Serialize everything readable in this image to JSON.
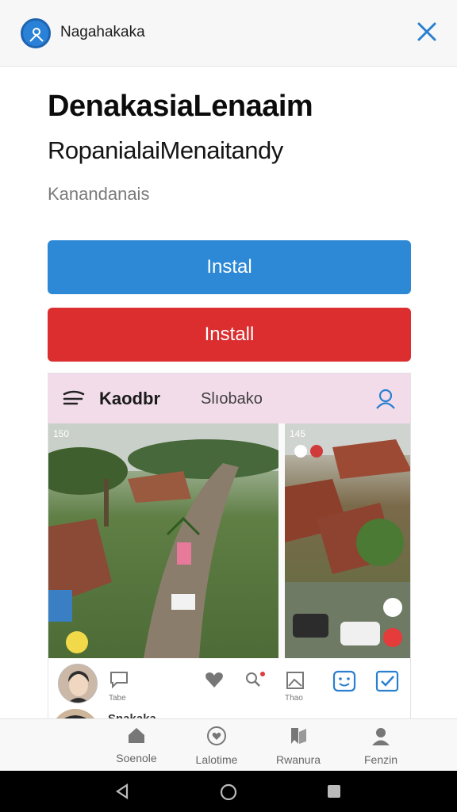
{
  "topbar": {
    "app_name": "Nagahakaka",
    "logo_icon": "person-icon",
    "close_icon": "close-icon"
  },
  "hero": {
    "title": "DenakasiaLenaaim",
    "subtitle": "RopanialaiMenaitandy",
    "caption": "Kanandanais"
  },
  "buttons": {
    "primary_label": "Instal",
    "secondary_label": "Install"
  },
  "preview": {
    "brand": "Kaodbr",
    "tab": "Slıobako",
    "left_photo_alt": "aerial-village-road-photo",
    "right_photo_alt": "village-rooftops-photo",
    "overlay_left": "150",
    "overlay_right": "145",
    "actions": [
      {
        "icon": "comment-icon",
        "label": "Tabe"
      },
      {
        "icon": "heart-icon",
        "label": ""
      },
      {
        "icon": "search-icon",
        "label": ""
      },
      {
        "icon": "image-icon",
        "label": "Thao"
      },
      {
        "icon": "smile-icon",
        "label": ""
      },
      {
        "icon": "check-icon",
        "label": ""
      }
    ],
    "peek_text": "Snakaka"
  },
  "bottom_nav": {
    "items": [
      {
        "icon": "home-icon",
        "label": "Soenole"
      },
      {
        "icon": "heart-icon",
        "label": "Lalotime"
      },
      {
        "icon": "bookmark-icon",
        "label": "Rwanura"
      },
      {
        "icon": "person-icon",
        "label": "Fenzin"
      }
    ]
  },
  "colors": {
    "accent_blue": "#2d88d6",
    "accent_red": "#dc2d2f",
    "preview_header": "#f3dcea"
  }
}
